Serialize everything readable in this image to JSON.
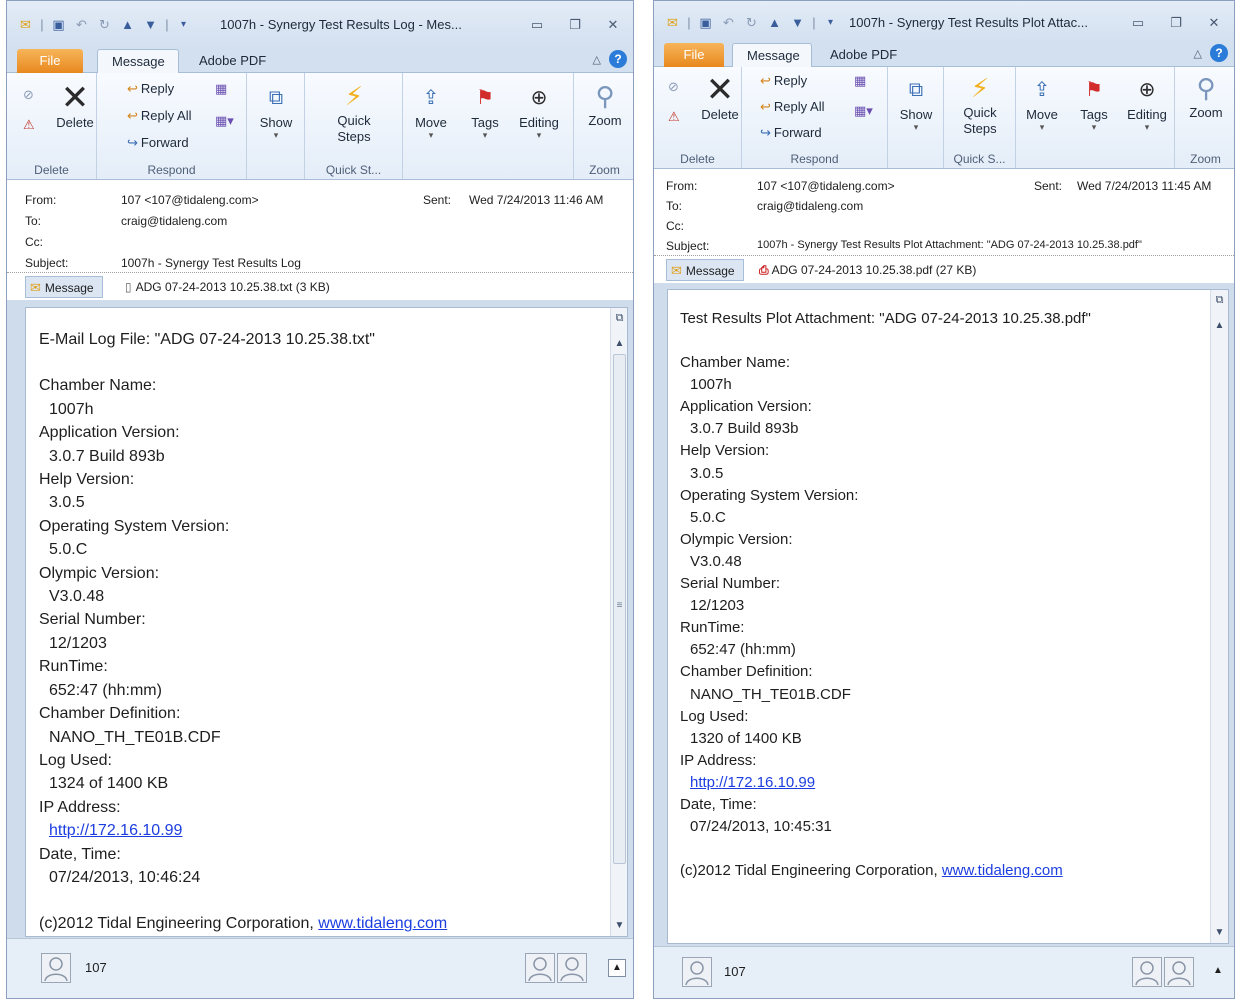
{
  "window1": {
    "title": "1007h - Synergy Test Results Log  -  Mes...",
    "tabs": {
      "file": "File",
      "message": "Message",
      "adobe": "Adobe PDF"
    },
    "ribbon": {
      "delete": "Delete",
      "delete_group": "Delete",
      "reply": "Reply",
      "reply_all": "Reply All",
      "forward": "Forward",
      "respond_group": "Respond",
      "show": "Show",
      "quick_steps": "Quick Steps",
      "quick_group": "Quick St...",
      "move": "Move",
      "tags": "Tags",
      "editing": "Editing",
      "zoom": "Zoom",
      "zoom_group": "Zoom"
    },
    "header": {
      "from_label": "From:",
      "from": "107 <107@tidaleng.com>",
      "sent_label": "Sent:",
      "sent": "Wed 7/24/2013 11:46 AM",
      "to_label": "To:",
      "to": "craig@tidaleng.com",
      "cc_label": "Cc:",
      "subject_label": "Subject:",
      "subject": "1007h - Synergy Test Results Log"
    },
    "attachments": {
      "message": "Message",
      "file": "ADG 07-24-2013 10.25.38.txt (3 KB)"
    },
    "body": {
      "l0": "E-Mail Log File: \"ADG 07-24-2013 10.25.38.txt\"",
      "l1": "Chamber Name:",
      "l2": "1007h",
      "l3": "Application Version:",
      "l4": "3.0.7 Build 893b",
      "l5": "Help Version:",
      "l6": "3.0.5",
      "l7": "Operating System Version:",
      "l8": "5.0.C",
      "l9": "Olympic Version:",
      "l10": "V3.0.48",
      "l11": "Serial Number:",
      "l12": "12/1203",
      "l13": "RunTime:",
      "l14": "652:47 (hh:mm)",
      "l15": "Chamber Definition:",
      "l16": "NANO_TH_TE01B.CDF",
      "l17": "Log Used:",
      "l18": "1324 of 1400 KB",
      "l19": "IP Address:",
      "l20": "http://172.16.10.99",
      "l21": "Date, Time:",
      "l22": "07/24/2013, 10:46:24",
      "l23": "(c)2012 Tidal Engineering Corporation, ",
      "l23_link": "www.tidaleng.com"
    },
    "footer": {
      "name": "107"
    }
  },
  "window2": {
    "title": "1007h - Synergy Test Results Plot Attac...",
    "tabs": {
      "file": "File",
      "message": "Message",
      "adobe": "Adobe PDF"
    },
    "ribbon": {
      "delete": "Delete",
      "delete_group": "Delete",
      "reply": "Reply",
      "reply_all": "Reply All",
      "forward": "Forward",
      "respond_group": "Respond",
      "show": "Show",
      "quick_steps": "Quick Steps",
      "quick_group": "Quick S...",
      "move": "Move",
      "tags": "Tags",
      "editing": "Editing",
      "zoom": "Zoom",
      "zoom_group": "Zoom"
    },
    "header": {
      "from_label": "From:",
      "from": "107 <107@tidaleng.com>",
      "sent_label": "Sent:",
      "sent": "Wed 7/24/2013 11:45 AM",
      "to_label": "To:",
      "to": "craig@tidaleng.com",
      "cc_label": "Cc:",
      "subject_label": "Subject:",
      "subject": "1007h - Synergy Test Results Plot Attachment: \"ADG 07-24-2013 10.25.38.pdf\""
    },
    "attachments": {
      "message": "Message",
      "file": "ADG 07-24-2013 10.25.38.pdf (27 KB)"
    },
    "body": {
      "l0": "Test Results Plot Attachment: \"ADG 07-24-2013 10.25.38.pdf\"",
      "l1": "Chamber Name:",
      "l2": "1007h",
      "l3": "Application Version:",
      "l4": "3.0.7 Build 893b",
      "l5": "Help Version:",
      "l6": "3.0.5",
      "l7": "Operating System Version:",
      "l8": "5.0.C",
      "l9": "Olympic Version:",
      "l10": "V3.0.48",
      "l11": "Serial Number:",
      "l12": "12/1203",
      "l13": "RunTime:",
      "l14": "652:47 (hh:mm)",
      "l15": "Chamber Definition:",
      "l16": "NANO_TH_TE01B.CDF",
      "l17": "Log Used:",
      "l18": "1320 of 1400 KB",
      "l19": "IP Address:",
      "l20": "http://172.16.10.99",
      "l21": "Date, Time:",
      "l22": "07/24/2013, 10:45:31",
      "l23": "(c)2012 Tidal Engineering Corporation, ",
      "l23_link": "www.tidaleng.com"
    },
    "footer": {
      "name": "107"
    }
  },
  "icons": {
    "envelope": "envelope-icon",
    "save": "save-icon",
    "undo": "undo-icon",
    "redo": "redo-icon",
    "up": "up-arrow-icon",
    "down": "down-arrow-icon",
    "customize": "customize-qat-icon",
    "minimize": "minimize-icon",
    "restore": "restore-icon",
    "close": "close-icon",
    "help": "help-icon",
    "delete": "delete-x-icon",
    "ignore": "ignore-icon",
    "junk": "junk-icon",
    "reply": "reply-icon",
    "reply_all": "reply-all-icon",
    "forward": "forward-icon",
    "meeting": "meeting-icon",
    "more": "more-respond-icon",
    "show": "show-icon",
    "quick_steps": "lightning-icon",
    "move": "move-icon",
    "tags": "flag-icon",
    "editing": "binoculars-icon",
    "zoom": "magnifier-icon",
    "pdf": "pdf-icon",
    "text_file": "text-file-icon",
    "avatar": "person-avatar-icon",
    "expand": "expand-people-pane-icon"
  },
  "colors": {
    "accent": "#2b7bd8",
    "file_tab": "#e8881e",
    "link": "#1c3ee0",
    "chrome": "#cfdcec"
  }
}
